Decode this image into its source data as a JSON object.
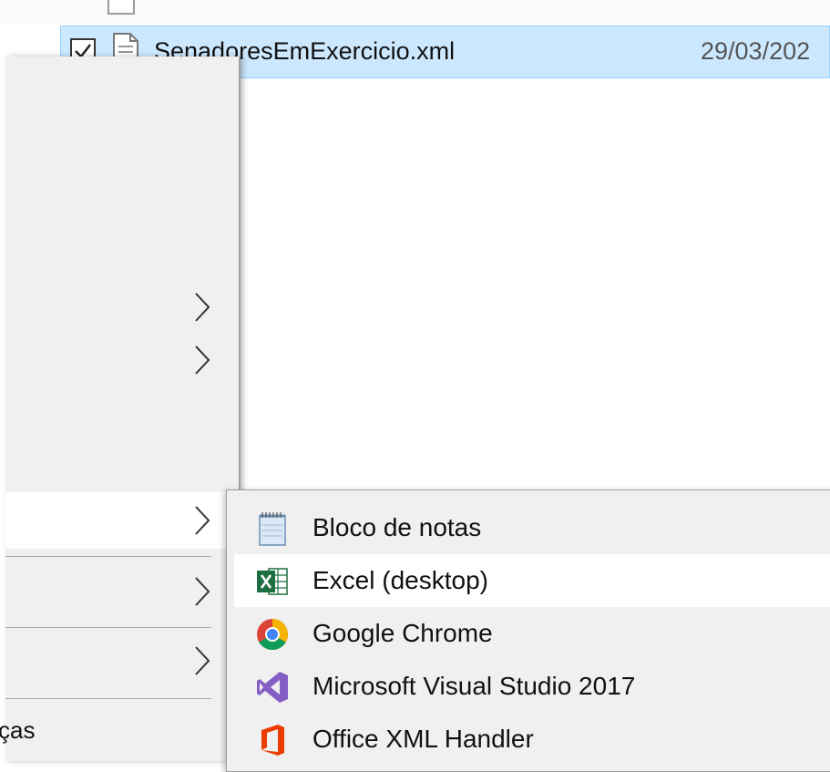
{
  "file_list": {
    "selected_file": {
      "name": "SenadoresEmExercicio.xml",
      "date": "29/03/202"
    }
  },
  "context_menu": {
    "partial_item_label": "ças"
  },
  "open_with_submenu": {
    "items": [
      {
        "label": "Bloco de notas",
        "icon": "notepad-icon"
      },
      {
        "label": "Excel (desktop)",
        "icon": "excel-icon"
      },
      {
        "label": "Google Chrome",
        "icon": "chrome-icon"
      },
      {
        "label": "Microsoft Visual Studio 2017",
        "icon": "visual-studio-icon"
      },
      {
        "label": "Office XML Handler",
        "icon": "office-icon"
      }
    ]
  },
  "colors": {
    "selection_bg": "#cce8ff",
    "selection_border": "#99d1ff",
    "menu_bg": "#f0f0f0",
    "hover_bg": "#ffffff"
  }
}
